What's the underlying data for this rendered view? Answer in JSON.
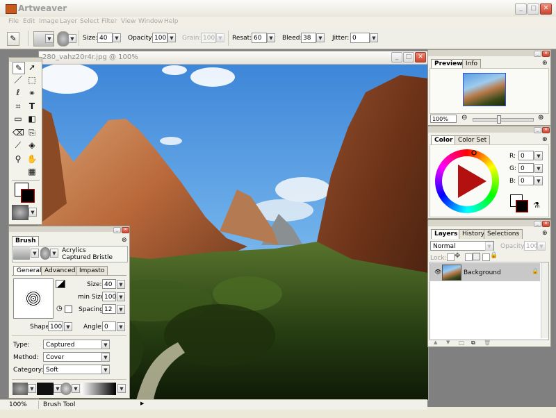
{
  "app": {
    "title": "Artweaver"
  },
  "menu": [
    "File",
    "Edit",
    "Image",
    "Layer",
    "Select",
    "Filter",
    "View",
    "Window",
    "Help"
  ],
  "options": {
    "size_label": "Size:",
    "size_value": "40",
    "opacity_label": "Opacity:",
    "opacity_value": "100",
    "grain_label": "Grain:",
    "grain_value": "100",
    "resat_label": "Resat:",
    "resat_value": "60",
    "bleed_label": "Bleed:",
    "bleed_value": "38",
    "jitter_label": "Jitter:",
    "jitter_value": "0"
  },
  "document": {
    "title": "280_vahz20r4r.jpg @ 100%"
  },
  "brush_panel": {
    "title": "Brush",
    "category_name": "Acrylics",
    "variant_name": "Captured Bristle",
    "tabs": [
      "General",
      "Advanced",
      "Impasto"
    ],
    "size_label": "Size:",
    "size_value": "40",
    "minsize_label": "min Size:",
    "minsize_value": "100",
    "spacing_label": "Spacing:",
    "spacing_value": "12",
    "shape_label": "Shape:",
    "shape_value": "100",
    "angle_label": "Angle:",
    "angle_value": "0",
    "type_label": "Type:",
    "type_value": "Captured",
    "method_label": "Method:",
    "method_value": "Cover",
    "category_label": "Category:",
    "category_value": "Soft"
  },
  "preview_panel": {
    "tabs": [
      "Preview",
      "Info"
    ],
    "zoom": "100%"
  },
  "color_panel": {
    "tabs": [
      "Color",
      "Color Set"
    ],
    "r_label": "R:",
    "r_value": "0",
    "g_label": "G:",
    "g_value": "0",
    "b_label": "B:",
    "b_value": "0"
  },
  "layers_panel": {
    "tabs": [
      "Layers",
      "History",
      "Selections"
    ],
    "blend_mode": "Normal",
    "opacity_label": "Opacity:",
    "opacity_value": "100",
    "lock_label": "Lock:",
    "layer_name": "Background"
  },
  "status": {
    "zoom": "100%",
    "tool": "Brush Tool"
  }
}
